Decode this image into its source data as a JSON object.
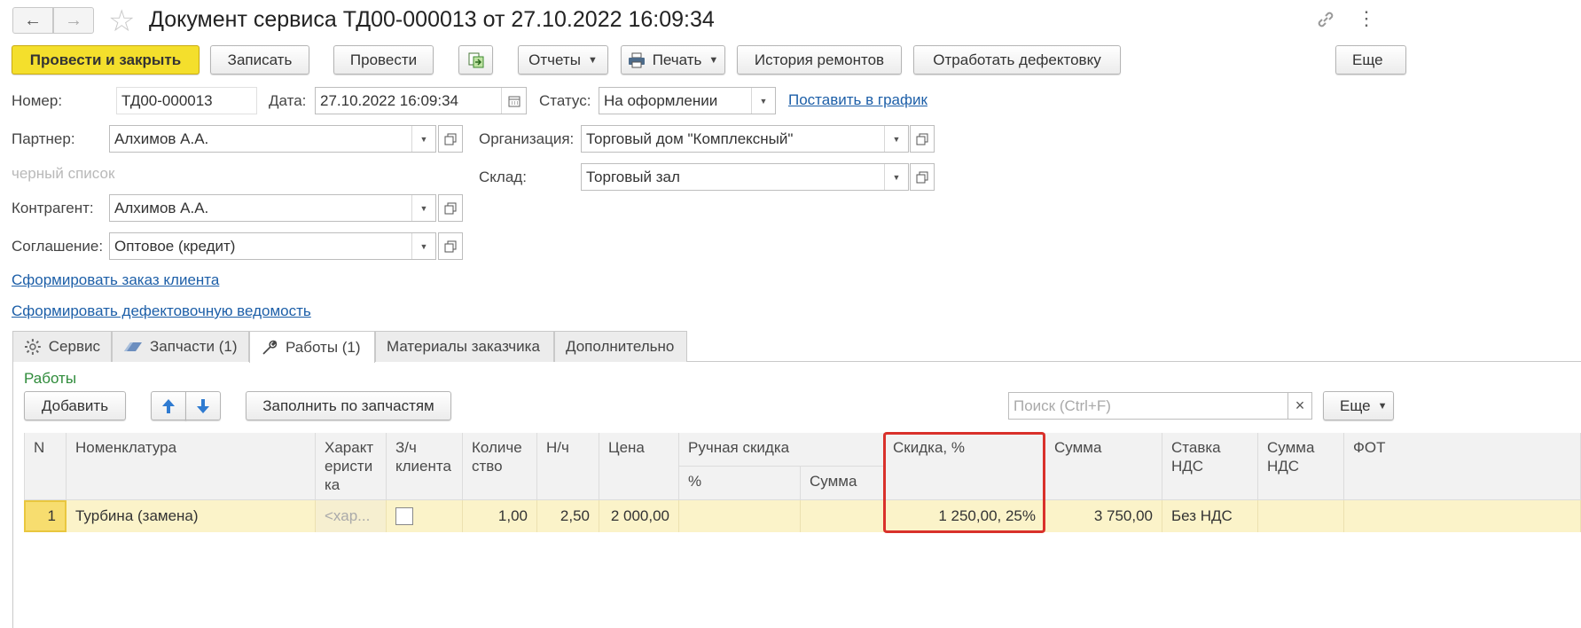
{
  "window": {
    "title": "Документ сервиса ТД00-000013 от 27.10.2022 16:09:34"
  },
  "toolbar": {
    "post_close": "Провести и закрыть",
    "save": "Записать",
    "post": "Провести",
    "reports": "Отчеты",
    "print": "Печать",
    "repair_history": "История ремонтов",
    "process_defects": "Отработать дефектовку",
    "more": "Еще"
  },
  "header": {
    "number_label": "Номер:",
    "number_value": "ТД00-000013",
    "date_label": "Дата:",
    "date_value": "27.10.2022 16:09:34",
    "status_label": "Статус:",
    "status_value": "На оформлении",
    "schedule_link": "Поставить в график",
    "partner_label": "Партнер:",
    "partner_value": "Алхимов А.А.",
    "blacklist": "черный список",
    "org_label": "Организация:",
    "org_value": "Торговый дом \"Комплексный\"",
    "warehouse_label": "Склад:",
    "warehouse_value": "Торговый зал",
    "counterparty_label": "Контрагент:",
    "counterparty_value": "Алхимов А.А.",
    "agreement_label": "Соглашение:",
    "agreement_value": "Оптовое (кредит)",
    "link_client_order": "Сформировать заказ клиента",
    "link_defect_sheet": "Сформировать дефектовочную ведомость"
  },
  "tabs": [
    {
      "label": "Сервис",
      "icon": "gear-icon"
    },
    {
      "label": "Запчасти (1)",
      "icon": "parts-icon"
    },
    {
      "label": "Работы (1)",
      "icon": "wrench-icon"
    },
    {
      "label": "Материалы заказчика"
    },
    {
      "label": "Дополнительно"
    }
  ],
  "works": {
    "section_title": "Работы",
    "add": "Добавить",
    "fill_by_parts": "Заполнить по запчастям",
    "search_placeholder": "Поиск (Ctrl+F)",
    "clear": "×",
    "more": "Еще",
    "columns": {
      "n": "N",
      "item": "Номенклатура",
      "charact": "Характ еристи ка",
      "client_part": "З/ч клиента",
      "qty": "Количе ство",
      "nh": "Н/ч",
      "price": "Цена",
      "manual_discount": "Ручная скидка",
      "manual_pct": "%",
      "manual_sum": "Сумма",
      "discount_pct": "Скидка, %",
      "sum": "Сумма",
      "vat_rate": "Ставка НДС",
      "vat_sum": "Сумма НДС",
      "fot": "ФОТ"
    },
    "rows": [
      {
        "n": "1",
        "item": "Турбина (замена)",
        "charact": "<хар...",
        "client_part": false,
        "qty": "1,00",
        "nh": "2,50",
        "price": "2 000,00",
        "manual_pct": "",
        "manual_sum": "",
        "discount": "1 250,00, 25%",
        "sum": "3 750,00",
        "vat_rate": "Без НДС",
        "vat_sum": "",
        "fot": ""
      }
    ]
  },
  "colors": {
    "primary_button": "#f4df2c",
    "link": "#1d5fa8",
    "section_title": "#2e8b3a",
    "selected_row": "#fbf3c9",
    "highlight_frame": "#d9312b"
  }
}
